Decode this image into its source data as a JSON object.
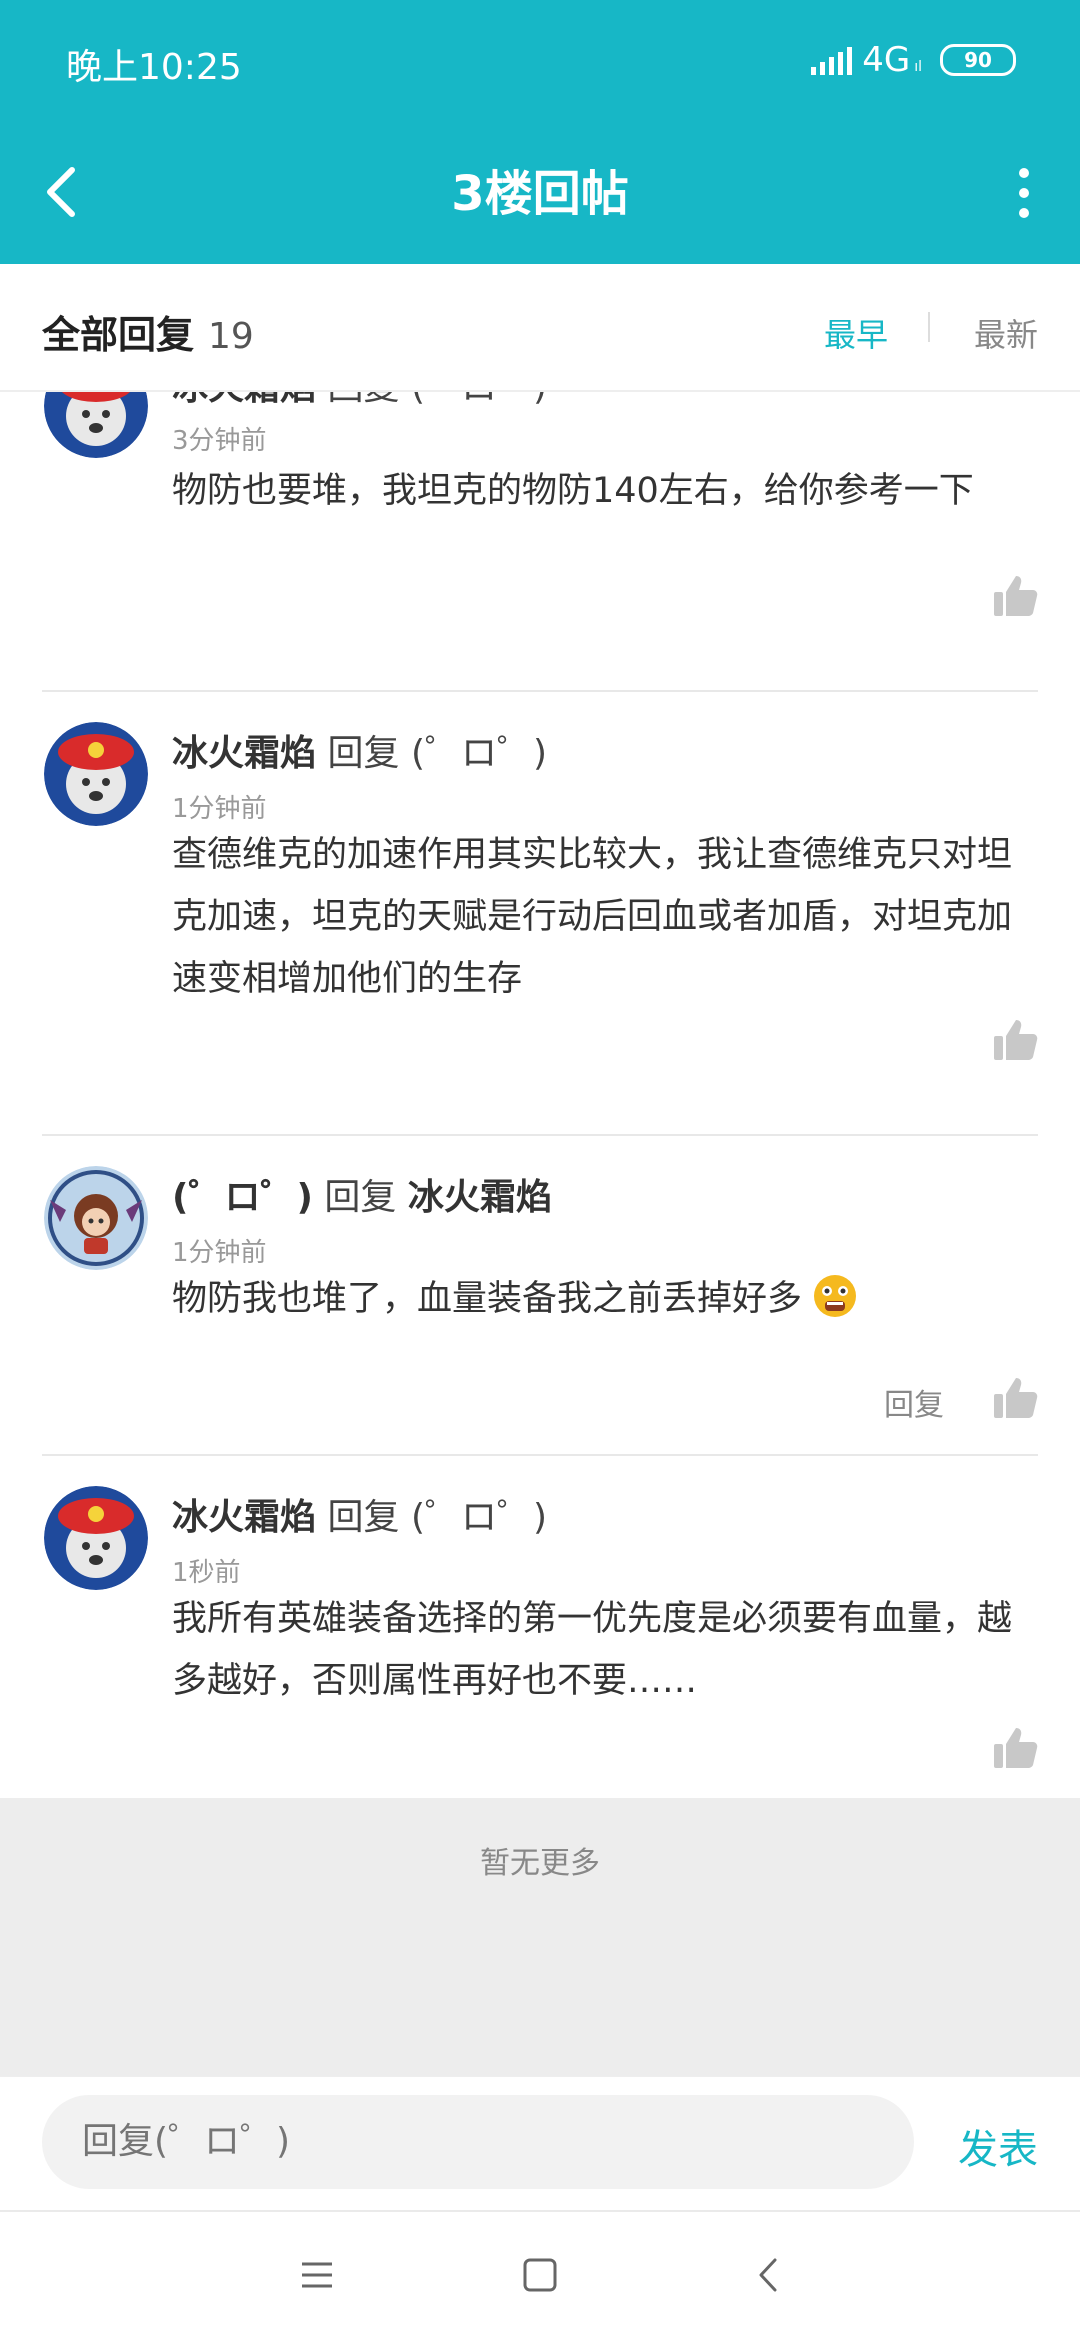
{
  "status_bar": {
    "time": "晚上10:25",
    "network": "4G",
    "network_sub": "ıl",
    "battery": "90"
  },
  "header": {
    "title": "3楼回帖"
  },
  "replies_bar": {
    "label": "全部回复",
    "count": "19",
    "sort_earliest": "最早",
    "sort_newest": "最新"
  },
  "replies": [
    {
      "user": "冰火霜焰",
      "reply_word": "回复",
      "target": "(゜ロ゜)",
      "time": "3分钟前",
      "text": "物防也要堆，我坦克的物防140左右，给你参考一下"
    },
    {
      "user": "冰火霜焰",
      "reply_word": "回复",
      "target": "(゜ロ゜)",
      "time": "1分钟前",
      "text": "查德维克的加速作用其实比较大，我让查德维克只对坦克加速，坦克的天赋是行动后回血或者加盾，对坦克加速变相增加他们的生存"
    },
    {
      "user": "(゜ロ゜)",
      "reply_word": "回复",
      "target": "冰火霜焰",
      "time": "1分钟前",
      "text": "物防我也堆了，血量装备我之前丢掉好多",
      "reply_action": "回复"
    },
    {
      "user": "冰火霜焰",
      "reply_word": "回复",
      "target": "(゜ロ゜)",
      "time": "1秒前",
      "text": "我所有英雄装备选择的第一优先度是必须要有血量，越多越好，否则属性再好也不要……"
    }
  ],
  "footer": {
    "no_more": "暂无更多"
  },
  "composer": {
    "placeholder": "回复(゜ロ゜)",
    "publish": "发表"
  },
  "colors": {
    "accent": "#17b7c6"
  }
}
